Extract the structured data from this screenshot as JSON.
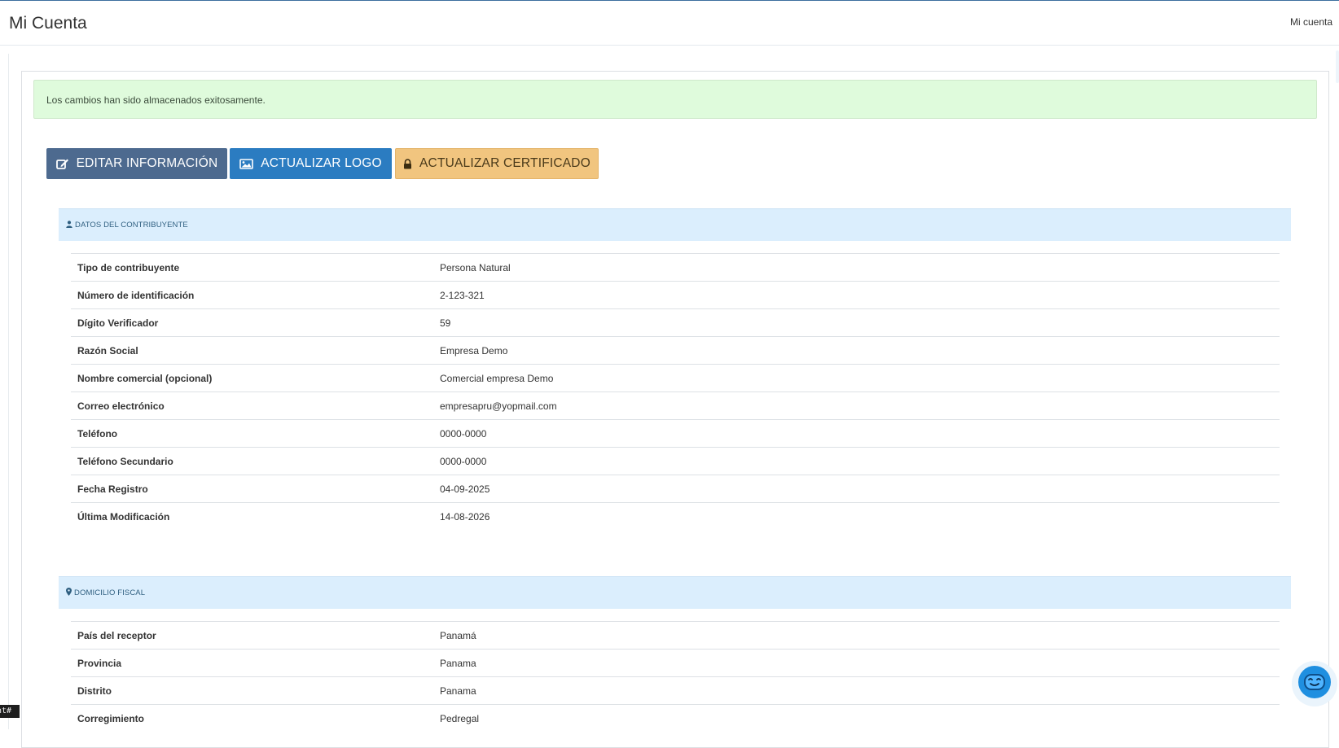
{
  "header": {
    "title": "Mi Cuenta",
    "account_link": "Mi cuenta"
  },
  "alert": {
    "message": "Los cambios han sido almacenados exitosamente."
  },
  "toolbar": {
    "edit_label": "EDITAR INFORMACIÓN",
    "logo_label": "ACTUALIZAR LOGO",
    "cert_label": "ACTUALIZAR CERTIFICADO"
  },
  "contribuyente": {
    "title": "DATOS DEL CONTRIBUYENTE",
    "rows": [
      {
        "label": "Tipo de contribuyente",
        "value": "Persona Natural"
      },
      {
        "label": "Número de identificación",
        "value": "2-123-321"
      },
      {
        "label": "Dígito Verificador",
        "value": "59"
      },
      {
        "label": "Razón Social",
        "value": "Empresa Demo"
      },
      {
        "label": "Nombre comercial (opcional)",
        "value": "Comercial empresa Demo"
      },
      {
        "label": "Correo electrónico",
        "value": "empresapru@yopmail.com"
      },
      {
        "label": "Teléfono",
        "value": "0000-0000"
      },
      {
        "label": "Teléfono Secundario",
        "value": "0000-0000"
      },
      {
        "label": "Fecha Registro",
        "value": "04-09-2025"
      },
      {
        "label": "Última Modificación",
        "value": "14-08-2026"
      }
    ]
  },
  "domicilio": {
    "title": "DOMICILIO FISCAL",
    "rows": [
      {
        "label": "País del receptor",
        "value": "Panamá"
      },
      {
        "label": "Provincia",
        "value": "Panama"
      },
      {
        "label": "Distrito",
        "value": "Panama"
      },
      {
        "label": "Corregimiento",
        "value": "Pedregal"
      }
    ]
  },
  "corner_tag": "nt#",
  "icons": {
    "edit": "edit-icon",
    "logo": "image-icon",
    "cert": "lock-icon",
    "user": "user-icon",
    "marker": "map-marker-icon",
    "bot": "chatbot-icon"
  },
  "colors": {
    "edit_button": "#4d6a8f",
    "logo_button": "#2b7cc1",
    "cert_button": "#f1c57f",
    "alert_bg": "#dffbdc",
    "section_bg": "#dbeefd"
  }
}
